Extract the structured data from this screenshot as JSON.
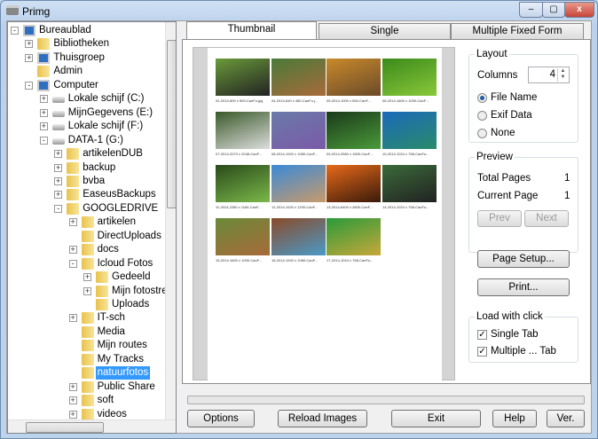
{
  "window": {
    "title": "Primg",
    "minimize": "–",
    "maximize": "▢",
    "close": "x"
  },
  "tree": [
    {
      "label": "Bureaublad",
      "level": 0,
      "exp": "-",
      "icon": "pc"
    },
    {
      "label": "Bibliotheken",
      "level": 1,
      "exp": "+",
      "icon": "folder"
    },
    {
      "label": "Thuisgroep",
      "level": 1,
      "exp": "+",
      "icon": "pc"
    },
    {
      "label": "Admin",
      "level": 1,
      "exp": "",
      "icon": "folder"
    },
    {
      "label": "Computer",
      "level": 1,
      "exp": "-",
      "icon": "pc"
    },
    {
      "label": "Lokale schijf (C:)",
      "level": 2,
      "exp": "+",
      "icon": "drive"
    },
    {
      "label": "MijnGegevens (E:)",
      "level": 2,
      "exp": "+",
      "icon": "drive"
    },
    {
      "label": "Lokale schijf (F:)",
      "level": 2,
      "exp": "+",
      "icon": "drive"
    },
    {
      "label": "DATA-1 (G:)",
      "level": 2,
      "exp": "-",
      "icon": "drive"
    },
    {
      "label": "artikelenDUB",
      "level": 3,
      "exp": "+",
      "icon": "folder"
    },
    {
      "label": "backup",
      "level": 3,
      "exp": "+",
      "icon": "folder"
    },
    {
      "label": "bvba",
      "level": 3,
      "exp": "+",
      "icon": "folder"
    },
    {
      "label": "EaseusBackups",
      "level": 3,
      "exp": "+",
      "icon": "folder"
    },
    {
      "label": "GOOGLEDRIVE",
      "level": 3,
      "exp": "-",
      "icon": "folder"
    },
    {
      "label": "artikelen",
      "level": 4,
      "exp": "+",
      "icon": "folder"
    },
    {
      "label": "DirectUploads",
      "level": 4,
      "exp": "",
      "icon": "folder"
    },
    {
      "label": "docs",
      "level": 4,
      "exp": "+",
      "icon": "folder"
    },
    {
      "label": "Icloud Fotos",
      "level": 4,
      "exp": "-",
      "icon": "folder"
    },
    {
      "label": "Gedeeld",
      "level": 5,
      "exp": "+",
      "icon": "folder"
    },
    {
      "label": "Mijn fotostre",
      "level": 5,
      "exp": "+",
      "icon": "folder"
    },
    {
      "label": "Uploads",
      "level": 5,
      "exp": "",
      "icon": "folder"
    },
    {
      "label": "IT-sch",
      "level": 4,
      "exp": "+",
      "icon": "folder"
    },
    {
      "label": "Media",
      "level": 4,
      "exp": "",
      "icon": "folder"
    },
    {
      "label": "Mijn routes",
      "level": 4,
      "exp": "",
      "icon": "folder"
    },
    {
      "label": "My Tracks",
      "level": 4,
      "exp": "",
      "icon": "folder"
    },
    {
      "label": "natuurfotos",
      "level": 4,
      "exp": "",
      "icon": "folder",
      "selected": true
    },
    {
      "label": "Public Share",
      "level": 4,
      "exp": "+",
      "icon": "folder"
    },
    {
      "label": "soft",
      "level": 4,
      "exp": "+",
      "icon": "folder"
    },
    {
      "label": "videos",
      "level": 4,
      "exp": "+",
      "icon": "folder"
    }
  ],
  "tabs": [
    "Thumbnail",
    "Single",
    "Multiple Fixed Form"
  ],
  "thumbnails": [
    {
      "caption": "02-2014-800 x 509-CanFu.jpg",
      "colors": [
        "#6a9a3a",
        "#222"
      ]
    },
    {
      "caption": "04-2014-640 x 480-CanFu.j...",
      "colors": [
        "#4a7a3a",
        "#a86a3a"
      ]
    },
    {
      "caption": "05-2014-1000 x 650-CanF...",
      "colors": [
        "#c98a2a",
        "#6a4a2a"
      ]
    },
    {
      "caption": "06-2014-1600 x 1000-CanF...",
      "colors": [
        "#3a8a1a",
        "#8ac83a"
      ]
    },
    {
      "caption": "07-2014-2073 x 2048-CanF...",
      "colors": [
        "#3a5a2a",
        "#ddd"
      ]
    },
    {
      "caption": "08-2014-1920 x 1080-CanF...",
      "colors": [
        "#6a7aa8",
        "#7a5aa8"
      ]
    },
    {
      "caption": "09-2014-2560 x 1600-CanF...",
      "colors": [
        "#1a3a1a",
        "#4a9a3a"
      ]
    },
    {
      "caption": "10-2014-1024 x 768-CanFu...",
      "colors": [
        "#1a6aba",
        "#2a8a6a"
      ]
    },
    {
      "caption": "11-2014-2280 x 1184-CanF...",
      "colors": [
        "#2a4a1a",
        "#7ab84a"
      ]
    },
    {
      "caption": "12-2014-1920 x 1200-CanF...",
      "colors": [
        "#3a8ad8",
        "#c89a6a"
      ]
    },
    {
      "caption": "13-2014-6400 x 4800-CanF...",
      "colors": [
        "#e86a1a",
        "#3a1a0a"
      ]
    },
    {
      "caption": "14-2014-1024 x 768-CanFu...",
      "colors": [
        "#3a6a3a",
        "#222"
      ]
    },
    {
      "caption": "15-2014-1600 x 1000-CanF...",
      "colors": [
        "#6a8a3a",
        "#a86a3a"
      ]
    },
    {
      "caption": "16-2014-1920 x 1080-CanF...",
      "colors": [
        "#8a4a2a",
        "#4a9ac8"
      ]
    },
    {
      "caption": "17-2014-1024 x 768-CanFu...",
      "colors": [
        "#2a9a3a",
        "#c8a83a"
      ]
    }
  ],
  "layout": {
    "title": "Layout",
    "columns_label": "Columns",
    "columns_value": "4",
    "options": [
      "File Name",
      "Exif Data",
      "None"
    ],
    "selected": 0
  },
  "preview": {
    "title": "Preview",
    "total_label": "Total Pages",
    "total_value": "1",
    "current_label": "Current Page",
    "current_value": "1",
    "prev": "Prev",
    "next": "Next"
  },
  "page_setup": "Page Setup...",
  "print": "Print...",
  "load": {
    "title": "Load with click",
    "single": "Single Tab",
    "multiple": "Multiple ... Tab",
    "single_checked": true,
    "multiple_checked": true
  },
  "progress": 0,
  "bottom": {
    "options": "Options",
    "reload": "Reload Images",
    "exit": "Exit",
    "help": "Help",
    "ver": "Ver."
  }
}
